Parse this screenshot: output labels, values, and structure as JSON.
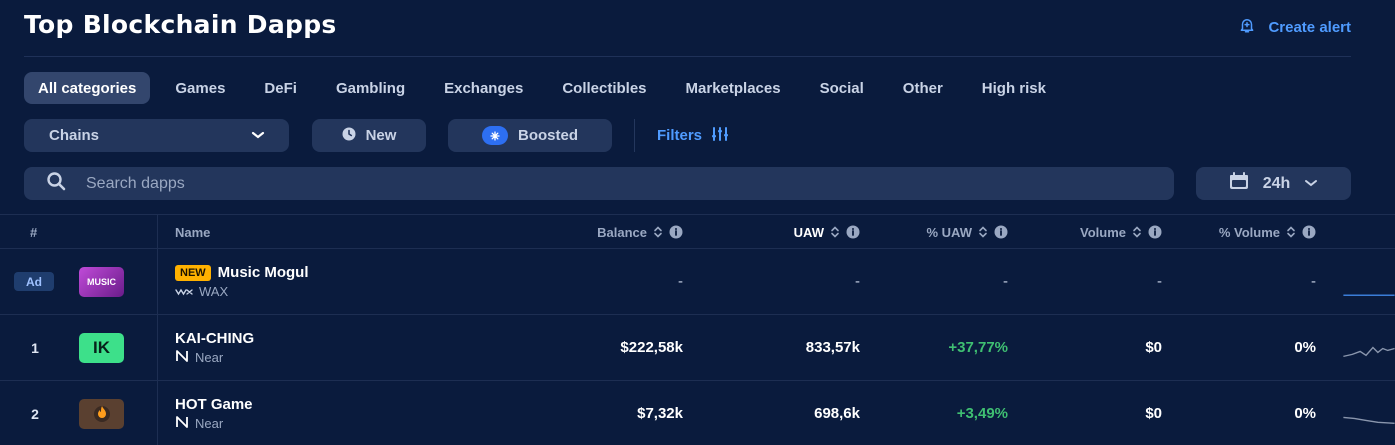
{
  "page": {
    "title": "Top Blockchain Dapps",
    "create_alert_label": "Create alert"
  },
  "categories": [
    {
      "label": "All categories",
      "active": true
    },
    {
      "label": "Games"
    },
    {
      "label": "DeFi"
    },
    {
      "label": "Gambling"
    },
    {
      "label": "Exchanges"
    },
    {
      "label": "Collectibles"
    },
    {
      "label": "Marketplaces"
    },
    {
      "label": "Social"
    },
    {
      "label": "Other"
    },
    {
      "label": "High risk"
    }
  ],
  "filters": {
    "chains_label": "Chains",
    "new_label": "New",
    "boosted_label": "Boosted",
    "filters_label": "Filters"
  },
  "search": {
    "placeholder": "Search dapps"
  },
  "time_range": {
    "selected": "24h"
  },
  "table": {
    "headers": {
      "rank": "#",
      "name": "Name",
      "balance": "Balance",
      "uaw": "UAW",
      "pct_uaw": "% UAW",
      "volume": "Volume",
      "pct_volume": "% Volume"
    },
    "rows": [
      {
        "rank": "Ad",
        "is_ad": true,
        "badge": "NEW",
        "name": "Music Mogul",
        "chain": "WAX",
        "logo_text": "MUSIC",
        "balance": "-",
        "uaw": "-",
        "pct_uaw": "-",
        "volume": "-",
        "pct_volume": "-"
      },
      {
        "rank": "1",
        "name": "KAI-CHING",
        "chain": "Near",
        "logo_text": "IK",
        "balance": "$222,58k",
        "uaw": "833,57k",
        "pct_uaw": "+37,77%",
        "volume": "$0",
        "pct_volume": "0%"
      },
      {
        "rank": "2",
        "name": "HOT Game",
        "chain": "Near",
        "balance": "$7,32k",
        "uaw": "698,6k",
        "pct_uaw": "+3,49%",
        "volume": "$0",
        "pct_volume": "0%"
      }
    ]
  },
  "colors": {
    "background": "#0a1b3d",
    "accent": "#4f9bff",
    "positive": "#3fbf72",
    "new_badge": "#ffb100",
    "kai_ching_logo": "#3de08a"
  }
}
